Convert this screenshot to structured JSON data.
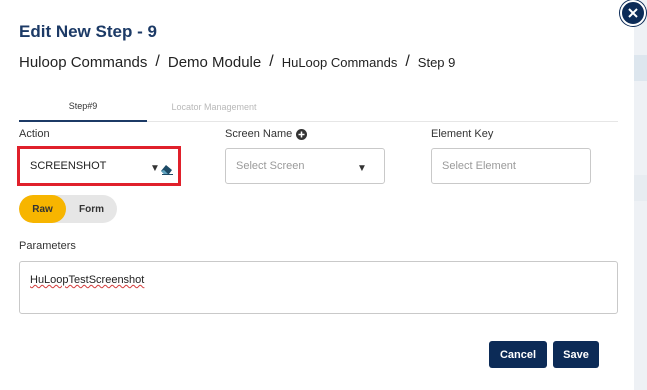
{
  "dialog": {
    "title": "Edit New Step - 9"
  },
  "breadcrumb": [
    "Huloop Commands",
    "Demo Module",
    "HuLoop Commands",
    "Step 9"
  ],
  "tabs": [
    {
      "label": "Step#9",
      "active": true
    },
    {
      "label": "Locator Management",
      "active": false
    }
  ],
  "form": {
    "action_label": "Action",
    "action_value": "SCREENSHOT",
    "screen_label": "Screen Name",
    "screen_placeholder": "Select Screen",
    "element_label": "Element Key",
    "element_placeholder": "Select Element",
    "mode_raw": "Raw",
    "mode_form": "Form",
    "parameters_label": "Parameters",
    "parameters_value": "HuLoopTestScreenshot"
  },
  "buttons": {
    "cancel": "Cancel",
    "save": "Save"
  },
  "colors": {
    "primary": "#0c2b57",
    "title": "#1c3a66",
    "highlight": "#e0202b",
    "toggle_active": "#f7b500"
  },
  "icons": [
    "close-icon",
    "add-circle-icon",
    "eraser-icon",
    "caret-down-icon"
  ]
}
